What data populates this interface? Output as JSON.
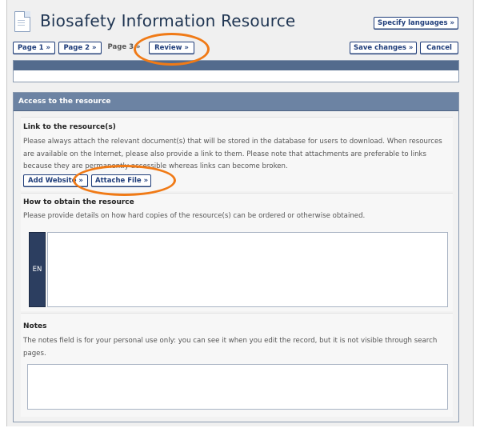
{
  "header": {
    "title": "Biosafety Information Resource",
    "specify_languages": "Specify languages »"
  },
  "nav": {
    "page1": "Page 1 »",
    "page2": "Page 2 »",
    "page3": "Page 3 »",
    "review": "Review »",
    "save": "Save changes »",
    "cancel": "Cancel"
  },
  "section": {
    "title": "Access to the resource",
    "link": {
      "title": "Link to the resource(s)",
      "desc": "Please always attach the relevant document(s) that will be stored in the database for users to download. When resources are available on the Internet, please also provide a link to them. Please note that attachments are preferable to links because they are permanently accessible whereas links can become broken.",
      "add_website": "Add Website »",
      "attach_file": "Attache File »"
    },
    "obtain": {
      "title": "How to obtain the resource",
      "desc": "Please provide details on how hard copies of the resource(s) can be ordered or otherwise obtained.",
      "lang": "EN",
      "value": ""
    },
    "notes": {
      "title": "Notes",
      "desc": "The notes field is for your personal use only: you can see it when you edit the record, but it is not visible through search pages.",
      "value": ""
    }
  },
  "annotations": {
    "color": "#f07a16"
  }
}
